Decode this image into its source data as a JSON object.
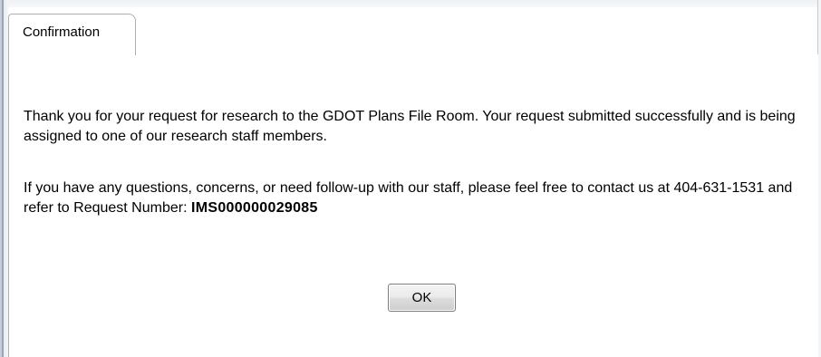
{
  "dialog": {
    "tab_label": "Confirmation",
    "message_line1": "Thank you for your request for research to the GDOT Plans File Room.  Your request submitted successfully and is being assigned to one of our research staff members.",
    "message_line2_prefix": "If you have any questions, concerns, or need follow-up with our staff, please feel free to contact us at 404-631-1531 and refer to Request Number: ",
    "request_number": "IMS000000029085",
    "ok_label": "OK"
  }
}
